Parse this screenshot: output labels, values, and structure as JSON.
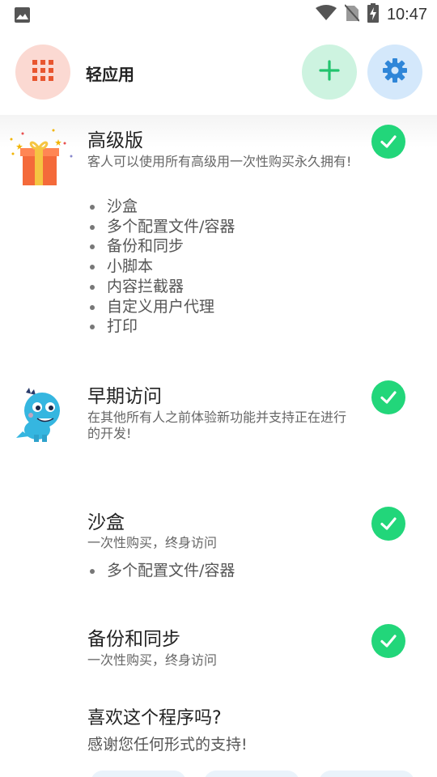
{
  "status_bar": {
    "time": "10:47"
  },
  "app_bar": {
    "title": "轻应用",
    "icons": {
      "apps": "grid-icon",
      "add": "plus-icon",
      "settings": "gear-icon"
    },
    "colors": {
      "apps_bg": "#fbd9d2",
      "apps_fg": "#e8552f",
      "add_bg": "#cdf3e0",
      "add_fg": "#22c46e",
      "settings_bg": "#d4e8fb",
      "settings_fg": "#2f86d8"
    }
  },
  "features": [
    {
      "title": "高级版",
      "description": "客人可以使用所有高级用一次性购买永久拥有!",
      "bullets": [
        "沙盒",
        "多个配置文件/容器",
        "备份和同步",
        "小脚本",
        "内容拦截器",
        "自定义用户代理",
        "打印"
      ],
      "status": "check-icon"
    },
    {
      "title": "早期访问",
      "description": "在其他所有人之前体验新功能并支持正在进行的开发!",
      "bullets": [],
      "status": "check-icon"
    },
    {
      "title": "沙盒",
      "description": "一次性购买，终身访问",
      "bullets": [
        "多个配置文件/容器"
      ],
      "status": "check-icon"
    },
    {
      "title": "备份和同步",
      "description": "一次性购买，终身访问",
      "bullets": [],
      "status": "check-icon"
    }
  ],
  "support": {
    "title": "喜欢这个程序吗?",
    "description": "感谢您任何形式的支持!"
  },
  "accent_check_color": "#22d67a"
}
